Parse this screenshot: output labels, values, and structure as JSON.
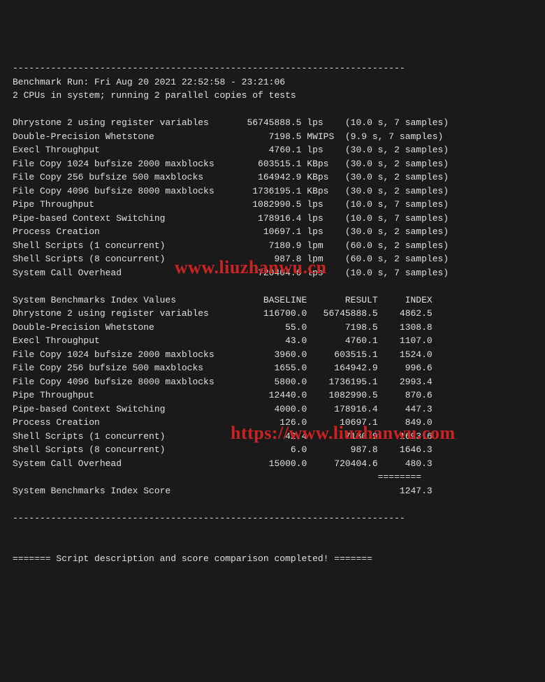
{
  "separator_top": "------------------------------------------------------------------------",
  "run_header": "Benchmark Run: Fri Aug 20 2021 22:52:58 - 23:21:06",
  "cpu_line": "2 CPUs in system; running 2 parallel copies of tests",
  "results": [
    {
      "name": "Dhrystone 2 using register variables",
      "value": "56745888.5",
      "unit": "lps",
      "timing": "(10.0 s, 7 samples)"
    },
    {
      "name": "Double-Precision Whetstone",
      "value": "7198.5",
      "unit": "MWIPS",
      "timing": "(9.9 s, 7 samples)"
    },
    {
      "name": "Execl Throughput",
      "value": "4760.1",
      "unit": "lps",
      "timing": "(30.0 s, 2 samples)"
    },
    {
      "name": "File Copy 1024 bufsize 2000 maxblocks",
      "value": "603515.1",
      "unit": "KBps",
      "timing": "(30.0 s, 2 samples)"
    },
    {
      "name": "File Copy 256 bufsize 500 maxblocks",
      "value": "164942.9",
      "unit": "KBps",
      "timing": "(30.0 s, 2 samples)"
    },
    {
      "name": "File Copy 4096 bufsize 8000 maxblocks",
      "value": "1736195.1",
      "unit": "KBps",
      "timing": "(30.0 s, 2 samples)"
    },
    {
      "name": "Pipe Throughput",
      "value": "1082990.5",
      "unit": "lps",
      "timing": "(10.0 s, 7 samples)"
    },
    {
      "name": "Pipe-based Context Switching",
      "value": "178916.4",
      "unit": "lps",
      "timing": "(10.0 s, 7 samples)"
    },
    {
      "name": "Process Creation",
      "value": "10697.1",
      "unit": "lps",
      "timing": "(30.0 s, 2 samples)"
    },
    {
      "name": "Shell Scripts (1 concurrent)",
      "value": "7180.9",
      "unit": "lpm",
      "timing": "(60.0 s, 2 samples)"
    },
    {
      "name": "Shell Scripts (8 concurrent)",
      "value": "987.8",
      "unit": "lpm",
      "timing": "(60.0 s, 2 samples)"
    },
    {
      "name": "System Call Overhead",
      "value": "720404.6",
      "unit": "lps",
      "timing": "(10.0 s, 7 samples)"
    }
  ],
  "index_header": {
    "label": "System Benchmarks Index Values",
    "baseline": "BASELINE",
    "result": "RESULT",
    "index": "INDEX"
  },
  "index_rows": [
    {
      "name": "Dhrystone 2 using register variables",
      "baseline": "116700.0",
      "result": "56745888.5",
      "index": "4862.5"
    },
    {
      "name": "Double-Precision Whetstone",
      "baseline": "55.0",
      "result": "7198.5",
      "index": "1308.8"
    },
    {
      "name": "Execl Throughput",
      "baseline": "43.0",
      "result": "4760.1",
      "index": "1107.0"
    },
    {
      "name": "File Copy 1024 bufsize 2000 maxblocks",
      "baseline": "3960.0",
      "result": "603515.1",
      "index": "1524.0"
    },
    {
      "name": "File Copy 256 bufsize 500 maxblocks",
      "baseline": "1655.0",
      "result": "164942.9",
      "index": "996.6"
    },
    {
      "name": "File Copy 4096 bufsize 8000 maxblocks",
      "baseline": "5800.0",
      "result": "1736195.1",
      "index": "2993.4"
    },
    {
      "name": "Pipe Throughput",
      "baseline": "12440.0",
      "result": "1082990.5",
      "index": "870.6"
    },
    {
      "name": "Pipe-based Context Switching",
      "baseline": "4000.0",
      "result": "178916.4",
      "index": "447.3"
    },
    {
      "name": "Process Creation",
      "baseline": "126.0",
      "result": "10697.1",
      "index": "849.0"
    },
    {
      "name": "Shell Scripts (1 concurrent)",
      "baseline": "42.4",
      "result": "7180.9",
      "index": "1693.6"
    },
    {
      "name": "Shell Scripts (8 concurrent)",
      "baseline": "6.0",
      "result": "987.8",
      "index": "1646.3"
    },
    {
      "name": "System Call Overhead",
      "baseline": "15000.0",
      "result": "720404.6",
      "index": "480.3"
    }
  ],
  "index_sep": "                                                                   ========",
  "index_score": {
    "label": "System Benchmarks Index Score",
    "value": "1247.3"
  },
  "separator_bot": "------------------------------------------------------------------------",
  "footer": "======= Script description and score comparison completed! =======",
  "watermark1": "www.liuzhanwu.cn",
  "watermark2": "https://www.liuzhanwu.com"
}
